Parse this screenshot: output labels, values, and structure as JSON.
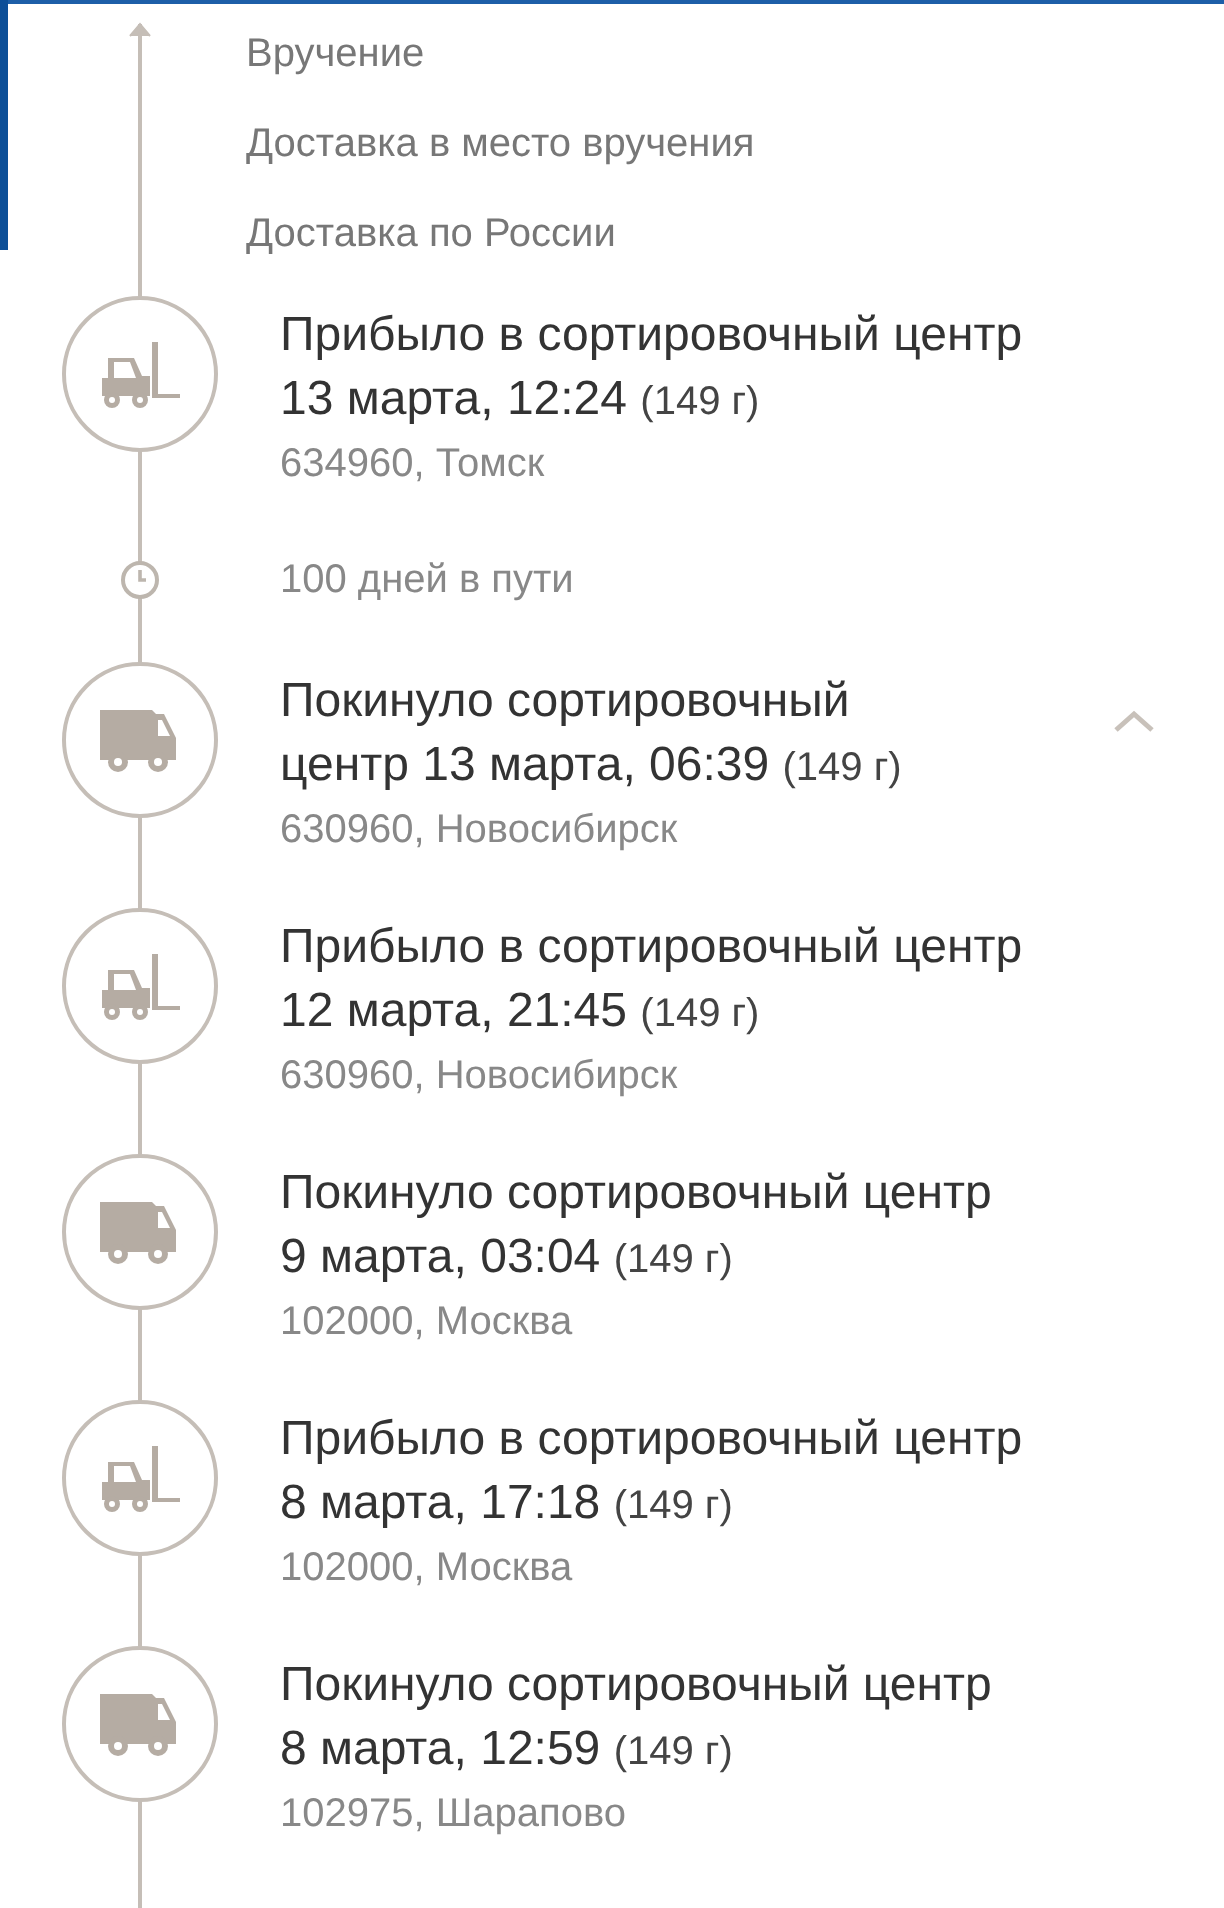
{
  "stages": [
    "Вручение",
    "Доставка в место вручения",
    "Доставка по России"
  ],
  "events": [
    {
      "kind": "arrived",
      "title": "Прибыло в сортировочный центр",
      "date": "13 марта, 12:24",
      "weight": "(149 г)",
      "place": "634960, Томск"
    },
    {
      "kind": "transit",
      "text": "100 дней в пути"
    },
    {
      "kind": "departed",
      "title": "Покинуло сортировочный центр",
      "date": "13 марта, 06:39",
      "weight": "(149 г)",
      "place": "630960, Новосибирск",
      "expanded": true
    },
    {
      "kind": "arrived",
      "title": "Прибыло в сортировочный центр",
      "date": "12 марта, 21:45",
      "weight": "(149 г)",
      "place": "630960, Новосибирск"
    },
    {
      "kind": "departed",
      "title": "Покинуло сортировочный центр",
      "date": "9 марта, 03:04",
      "weight": "(149 г)",
      "place": "102000, Москва"
    },
    {
      "kind": "arrived",
      "title": "Прибыло в сортировочный центр",
      "date": "8 марта, 17:18",
      "weight": "(149 г)",
      "place": "102000, Москва"
    },
    {
      "kind": "departed",
      "title": "Покинуло сортировочный центр",
      "date": "8 марта, 12:59",
      "weight": "(149 г)",
      "place": "102975, Шарапово"
    }
  ]
}
